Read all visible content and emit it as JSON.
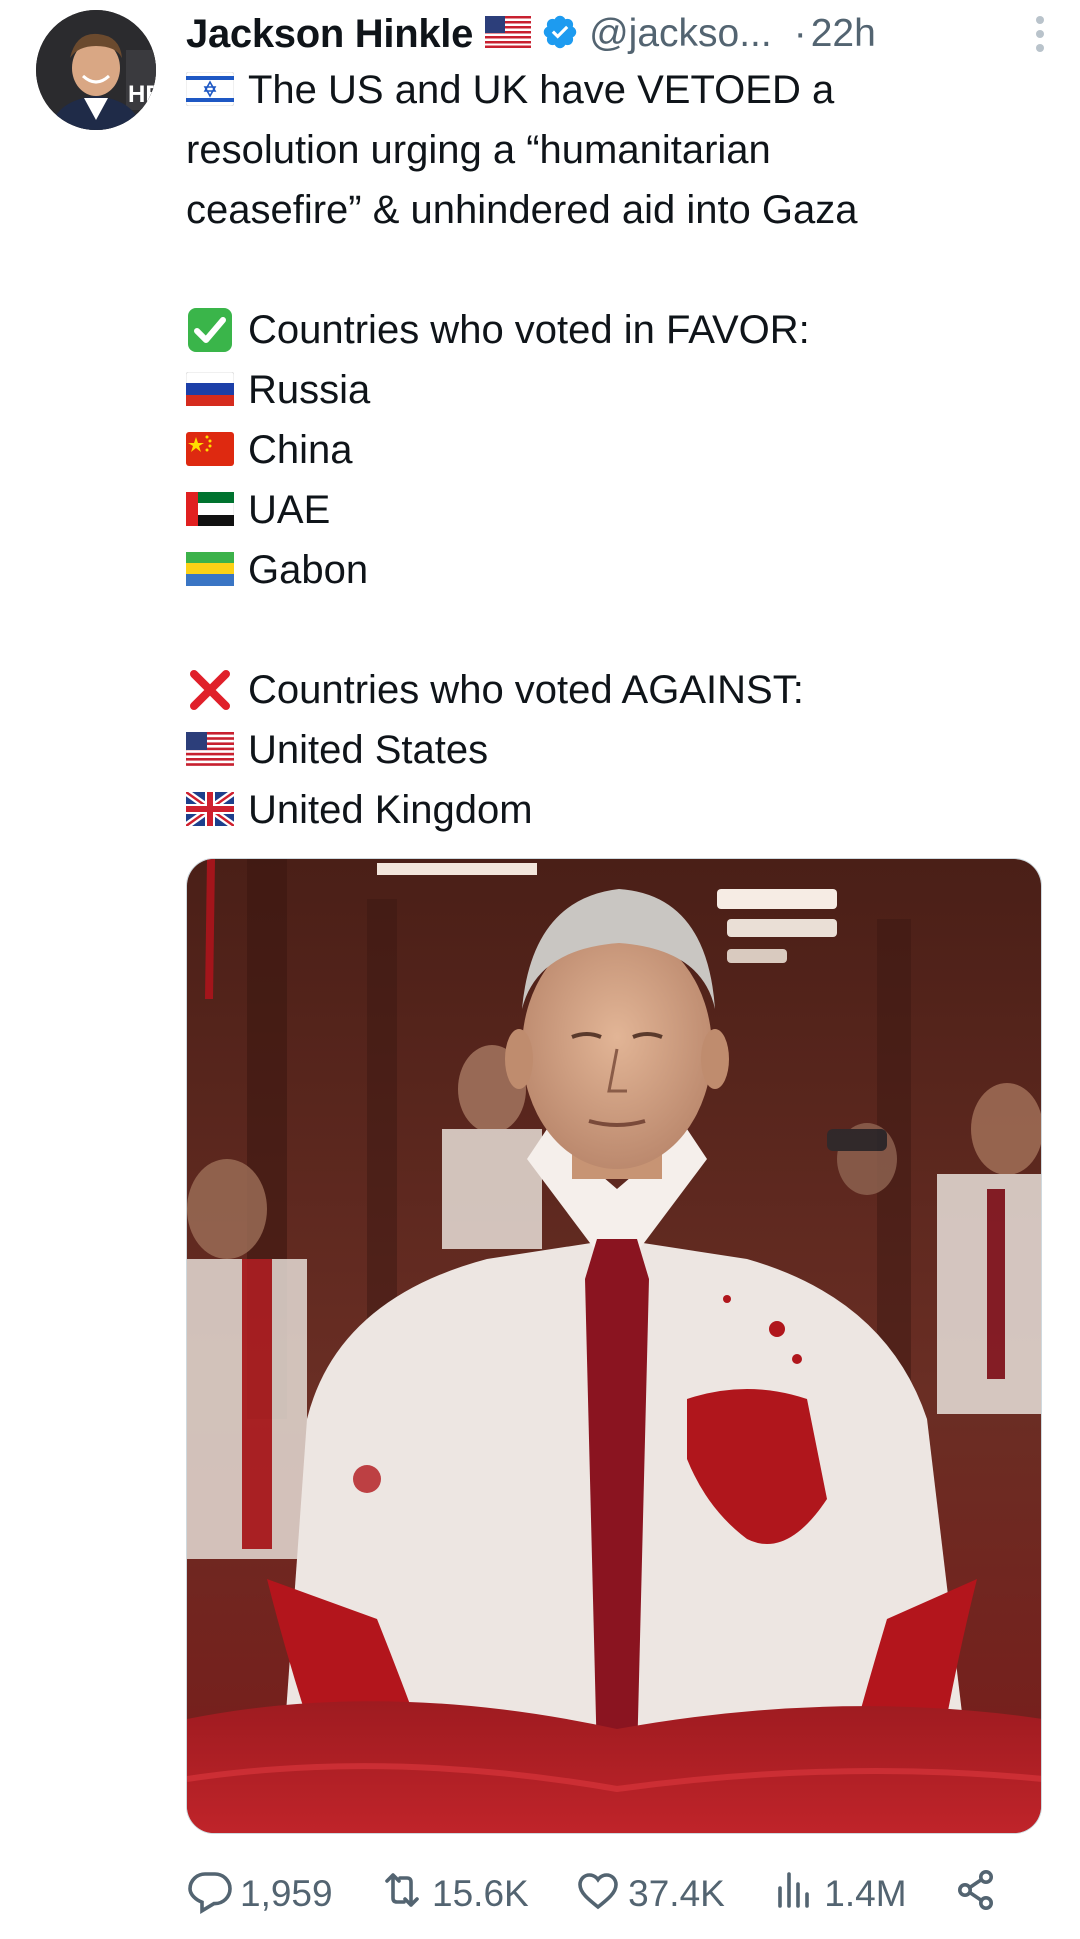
{
  "tweet": {
    "author_name": "Jackson Hinkle",
    "author_flag_icon": "us-flag-icon",
    "verified_icon": "verified-badge-icon",
    "handle": "@jackso...",
    "separator": "·",
    "time": "22h",
    "lines": [
      {
        "icon": "israel-flag-icon",
        "text": "The US and UK have VETOED a"
      },
      {
        "icon": "",
        "text": "resolution urging a “humanitarian"
      },
      {
        "icon": "",
        "text": "ceasefire” & unhindered aid into Gaza"
      },
      {
        "icon": "",
        "text": ""
      },
      {
        "icon": "check-mark-icon",
        "text": "Countries who voted in FAVOR:"
      },
      {
        "icon": "russia-flag-icon",
        "text": "Russia"
      },
      {
        "icon": "china-flag-icon",
        "text": "China"
      },
      {
        "icon": "uae-flag-icon",
        "text": "UAE"
      },
      {
        "icon": "gabon-flag-icon",
        "text": "Gabon"
      },
      {
        "icon": "",
        "text": ""
      },
      {
        "icon": "cross-mark-icon",
        "text": "Countries who voted AGAINST:"
      },
      {
        "icon": "us-flag-icon",
        "text": "United States"
      },
      {
        "icon": "uk-flag-icon",
        "text": "United Kingdom"
      }
    ]
  },
  "actions": {
    "replies": "1,959",
    "retweets": "15.6K",
    "likes": "37.4K",
    "views": "1.4M"
  },
  "colors": {
    "text": "#0f1419",
    "secondary": "#536471",
    "verified": "#1d9bf0"
  }
}
